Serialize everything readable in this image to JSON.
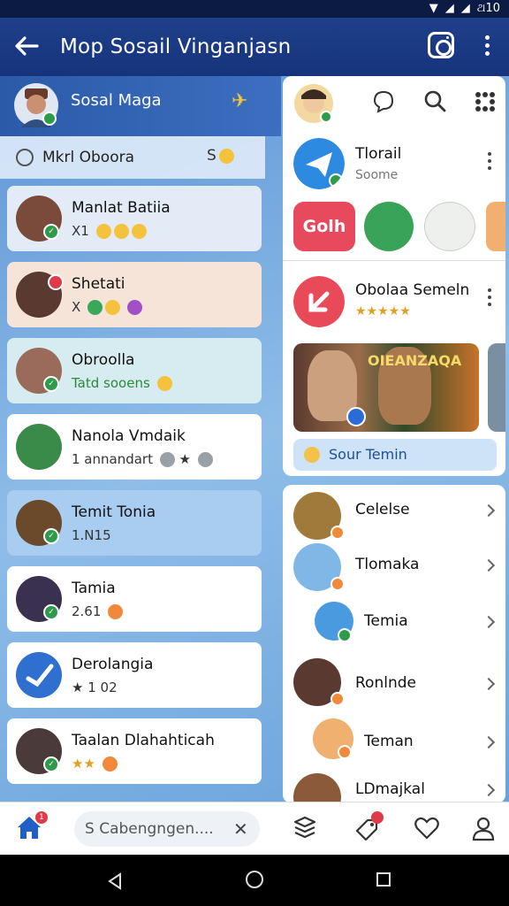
{
  "status_bar": {
    "time": "ଥ10"
  },
  "app_bar": {
    "title": "Mop Sosail Vinganjasn"
  },
  "profile": {
    "name": "Sosal Maga"
  },
  "left_search": {
    "label": "Mkrl Oboora",
    "tail": "S"
  },
  "chats": [
    {
      "name": "Manlat Batiia",
      "sub": "X1",
      "avatar_color": "#7a4a3a"
    },
    {
      "name": "Shetati",
      "sub": "X",
      "avatar_color": "#5a3a30"
    },
    {
      "name": "Obroolla",
      "sub": "Tatd sooens",
      "avatar_color": "#9a6a5a"
    },
    {
      "name": "Nanola Vmdaik",
      "sub": "1 annandart",
      "avatar_color": "#3a8a4a"
    },
    {
      "name": "Temit Tonia",
      "sub": "1.N15",
      "avatar_color": "#6a4a2a"
    },
    {
      "name": "Tamia",
      "sub": "2.61",
      "avatar_color": "#3a3050"
    },
    {
      "name": "Derolangia",
      "sub": "1 02",
      "avatar_color": "#2f6fd0"
    },
    {
      "name": "Taalan Dlahahticah",
      "sub": "",
      "avatar_color": "#4a3a3a"
    }
  ],
  "right": {
    "top_name": "Tlorail",
    "top_sub": "Soome",
    "bolt_label": "Golh",
    "feature_name": "Obolaa Semeln",
    "feature_stars": "★★★★★",
    "join_label": "Sour Temin",
    "photo_caption": "OIEANZAQA",
    "list": [
      {
        "name": "Celelse"
      },
      {
        "name": "Tlomaka"
      },
      {
        "name": "Temia"
      },
      {
        "name": "Ronlnde"
      },
      {
        "name": "Teman"
      },
      {
        "name": "LDmajkal"
      }
    ]
  },
  "bottom": {
    "search_placeholder": "S Cabengngen....",
    "clear": "✕",
    "home_badge": "1"
  },
  "colors": {
    "app_bar": "#1f3f8a",
    "accent_green": "#2e9b4a",
    "accent_red": "#e74a5c"
  }
}
